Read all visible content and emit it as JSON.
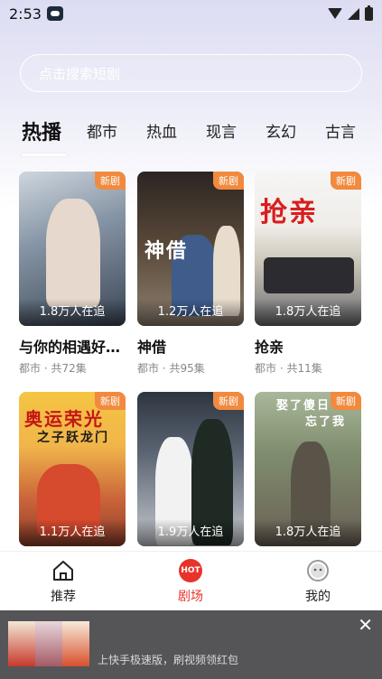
{
  "status_bar": {
    "time": "2:53"
  },
  "search": {
    "placeholder": "点击搜索短剧"
  },
  "tabs": [
    {
      "label": "热播",
      "active": true
    },
    {
      "label": "都市"
    },
    {
      "label": "热血"
    },
    {
      "label": "现言"
    },
    {
      "label": "玄幻"
    },
    {
      "label": "古言"
    }
  ],
  "cards": [
    {
      "title": "与你的相遇好…",
      "meta": "都市 · 共72集",
      "watchers": "1.8万人在追",
      "badge": "新剧"
    },
    {
      "title": "神借",
      "meta": "都市 · 共95集",
      "watchers": "1.2万人在追",
      "badge": "新剧",
      "poster_text": "神借"
    },
    {
      "title": "抢亲",
      "meta": "都市 · 共11集",
      "watchers": "1.8万人在追",
      "badge": "新剧",
      "poster_text": "抢亲"
    },
    {
      "watchers": "1.1万人在追",
      "badge": "新剧",
      "poster_text": "奥运荣光",
      "poster_subtext": "之子跃龙门"
    },
    {
      "watchers": "1.9万人在追",
      "badge": "新剧"
    },
    {
      "watchers": "1.8万人在追",
      "badge": "新剧",
      "poster_text": "娶了傻日",
      "poster_subtext": "忘了我"
    }
  ],
  "bottom_nav": [
    {
      "label": "推荐",
      "icon": "home-icon"
    },
    {
      "label": "剧场",
      "icon": "hot-icon",
      "icon_text": "HOT",
      "active": true
    },
    {
      "label": "我的",
      "icon": "profile-icon"
    }
  ],
  "ad": {
    "text": "上快手极速版，刷视频领红包",
    "close": "✕"
  },
  "colors": {
    "accent": "#e8332b",
    "badge": "#f18a3e"
  }
}
